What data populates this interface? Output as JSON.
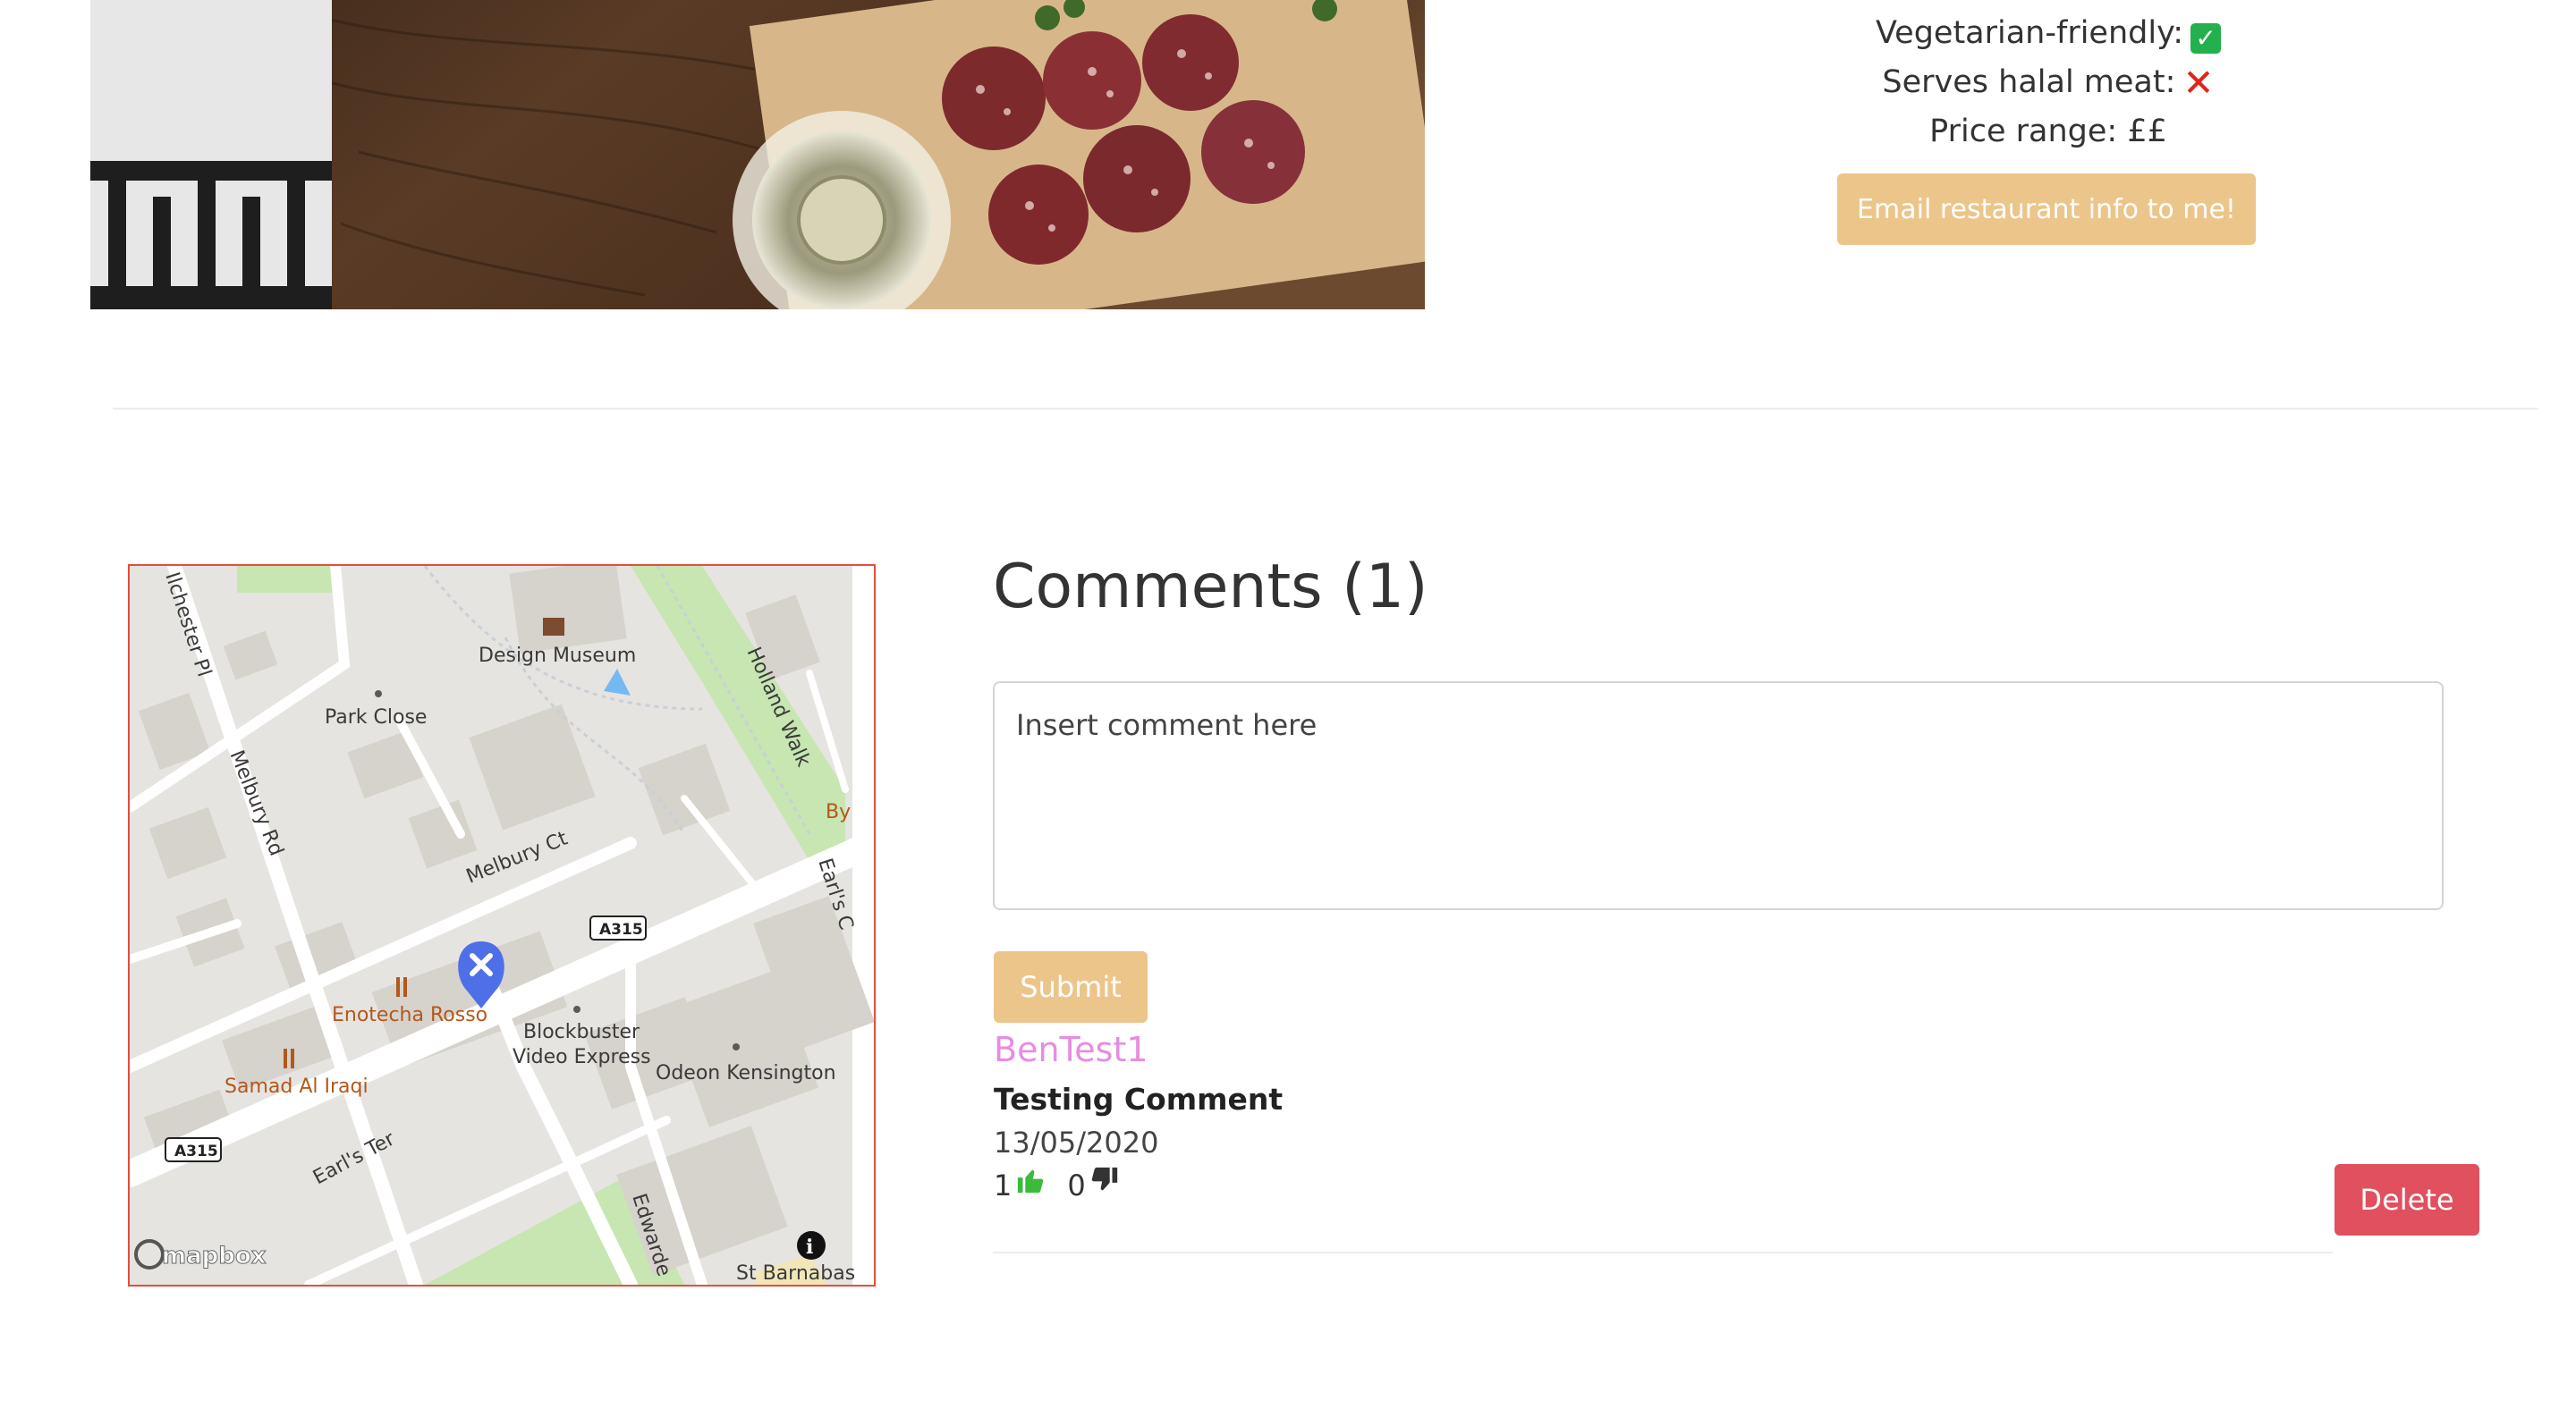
{
  "restaurant": {
    "vegetarian_label": "Vegetarian-friendly:",
    "vegetarian_icon": "check-mark-icon",
    "halal_label": "Serves halal meat:",
    "halal_icon": "cross-mark-icon",
    "price_label": "Price range: ££",
    "email_button": "Email restaurant info to me!"
  },
  "map": {
    "labels": {
      "design_museum": "Design Museum",
      "park_close": "Park Close",
      "ilchester": "Ilchester Pl",
      "melbury_rd": "Melbury Rd",
      "holland_walk": "Holland Walk",
      "melbury_ct": "Melbury Ct",
      "a315_1": "A315",
      "a315_2": "A315",
      "enotecha": "Enotecha Rosso",
      "samad": "Samad Al Iraqi",
      "blockbuster_1": "Blockbuster",
      "blockbuster_2": "Video Express",
      "odeon": "Odeon Kensington",
      "earls_ter": "Earl's Ter",
      "earls_ct": "Earl's C",
      "edwardes": "Edwarde",
      "by": "By",
      "st_barnabas": "St Barnabas",
      "brand": "mapbox"
    },
    "colors": {
      "marker": "#4f6fe8",
      "park": "#c7e6b2",
      "water": "#75b9f3",
      "border": "#e74c3c"
    }
  },
  "comments": {
    "title": "Comments (1)",
    "placeholder": "Insert comment here",
    "submit_label": "Submit",
    "items": [
      {
        "author": "BenTest1",
        "text": "Testing Comment",
        "date": "13/05/2020",
        "likes": "1",
        "dislikes": "0",
        "delete_label": "Delete"
      }
    ]
  },
  "colors": {
    "accent_button": "#ecc58a",
    "delete_button": "#e0505f",
    "author": "#e88ce0",
    "like": "#3cba3c",
    "dislike": "#333333"
  }
}
